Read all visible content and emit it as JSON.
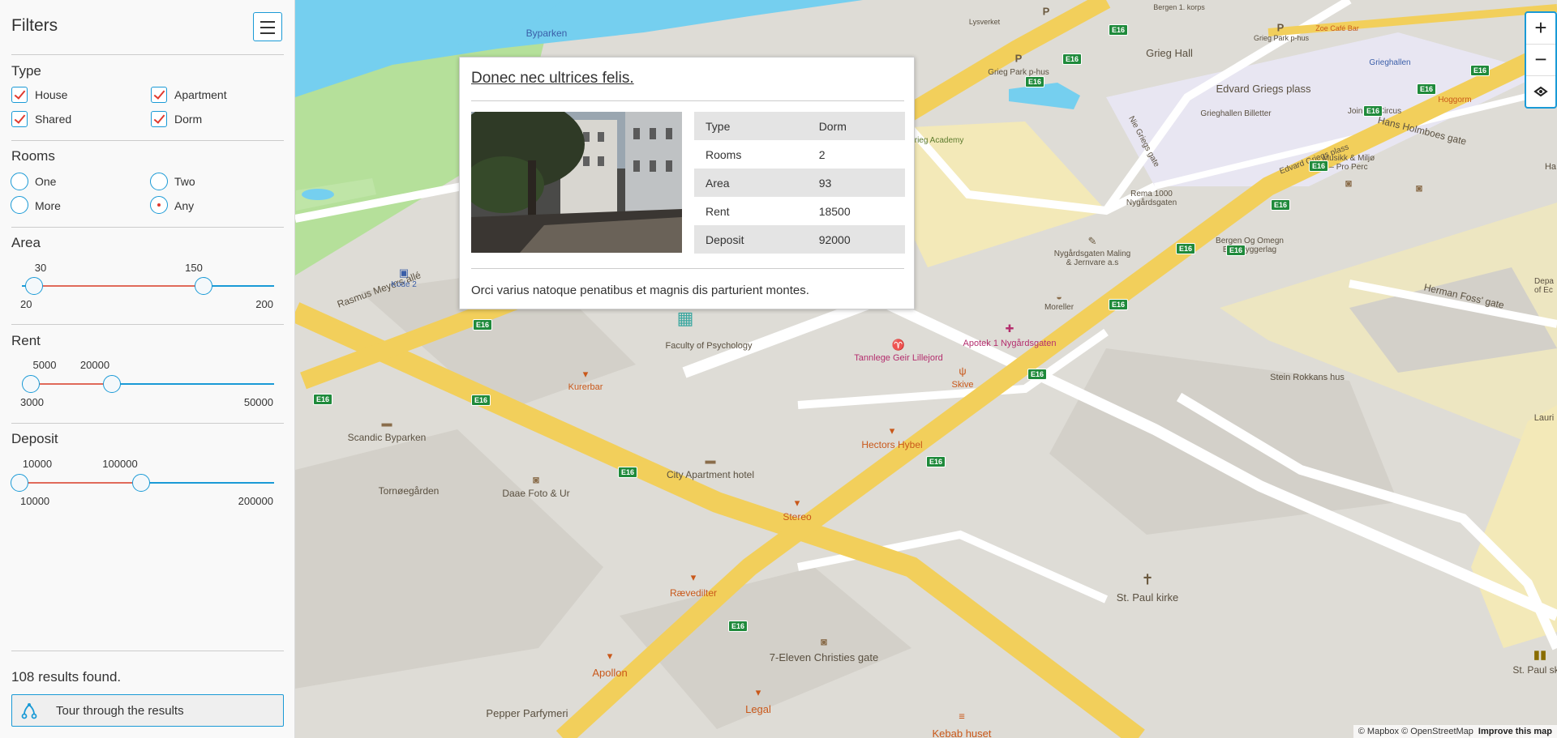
{
  "sidebar": {
    "title": "Filters",
    "menu_icon": "hamburger-icon",
    "type": {
      "heading": "Type",
      "options": [
        {
          "label": "House",
          "checked": true
        },
        {
          "label": "Apartment",
          "checked": true
        },
        {
          "label": "Shared",
          "checked": true
        },
        {
          "label": "Dorm",
          "checked": true
        }
      ]
    },
    "rooms": {
      "heading": "Rooms",
      "options": [
        {
          "label": "One",
          "selected": false
        },
        {
          "label": "Two",
          "selected": false
        },
        {
          "label": "More",
          "selected": false
        },
        {
          "label": "Any",
          "selected": true
        }
      ]
    },
    "area": {
      "heading": "Area",
      "low": "30",
      "high": "150",
      "min": "20",
      "max": "200"
    },
    "rent": {
      "heading": "Rent",
      "low": "5000",
      "high": "20000",
      "min": "3000",
      "max": "50000"
    },
    "deposit": {
      "heading": "Deposit",
      "low": "10000",
      "high": "100000",
      "min": "10000",
      "max": "200000"
    },
    "results_text": "108 results found.",
    "tour_button": "Tour through the results",
    "tour_icon": "route-icon"
  },
  "popup": {
    "title": "Donec nec ultrices felis.",
    "rows": [
      {
        "key": "Type",
        "value": "Dorm"
      },
      {
        "key": "Rooms",
        "value": "2"
      },
      {
        "key": "Area",
        "value": "93"
      },
      {
        "key": "Rent",
        "value": "18500"
      },
      {
        "key": "Deposit",
        "value": "92000"
      }
    ],
    "description": "Orci varius natoque penatibus et magnis dis parturient montes."
  },
  "map": {
    "labels": {
      "byparken": "Byparken",
      "grieg_hall": "Grieg Hall",
      "edvard_griegs_plass": "Edvard Griegs plass",
      "grieghallen": "Grieghallen",
      "grieghallen_billetter": "Grieghallen Billetter",
      "join_the_circus": "Join the Circus",
      "hoggorm": "Hoggorm",
      "grieg_park": "Grieg Park p-hus",
      "grieg_park_top": "Grieg Park p-hus",
      "lysverket": "Lysverket",
      "bergen_kopis": "Bergen 1. korps",
      "zoe_cafe": "Zoe Café Bar",
      "grieg_academy": "e Grieg Academy",
      "hans_holmboes": "Hans Holmboes gate",
      "edvard_griegs_plass_road": "Edvard Griegs plass",
      "nie_griegs": "Nie Griegs gate",
      "musikk": "Musikk & Miljø\n– Pro Perc",
      "rema": "Rema 1000\nNygårdsgaten",
      "nygardsgaten_maling": "Nygårdsgaten Maling\n& Jernvare a.s",
      "bergen_omegn": "Bergen Og Omegn\nBoligbyggerlag",
      "herman_foss": "Herman Foss' gate",
      "rasmus_meyers": "Rasmus Meyers allé",
      "kode2": "Kode 2",
      "moreller": "Moreller",
      "apotek": "Apotek 1 Nygårdsgaten",
      "tannlege": "Tannlege Geir Lillejord",
      "skive": "Skive",
      "faculty_psych": "Faculty of Psychology",
      "kurerbar": "Kurerbar",
      "scandic": "Scandic Byparken",
      "tornoegarden": "Tornøegården",
      "daae": "Daae Foto & Ur",
      "city_apartment": "City Apartment hotel",
      "hectors": "Hectors Hybel",
      "stereo": "Stereo",
      "stein_rokkans": "Stein Rokkans hus",
      "ravedilter": "Rævedilter",
      "st_paul": "St. Paul kirke",
      "apollon": "Apollon",
      "seven_eleven": "7-Eleven Christies gate",
      "legal": "Legal",
      "pepper": "Pepper Parfymeri",
      "kebab": "Kebab huset",
      "st_paul_s": "St. Paul sk",
      "lauri": "Lauri",
      "dep_ec": "Depa\nof Ec",
      "hum": "Ha"
    },
    "road_shield": "E16",
    "zoom_in": "+",
    "zoom_out": "−",
    "compass_icon": "compass-icon",
    "attribution": "© Mapbox © OpenStreetMap",
    "improve": "Improve this map"
  },
  "colors": {
    "accent": "#1a9ad6",
    "highlight": "#e03a2f",
    "road": "#f2cf5b",
    "water": "#75cfef",
    "park": "#b5e09a"
  }
}
